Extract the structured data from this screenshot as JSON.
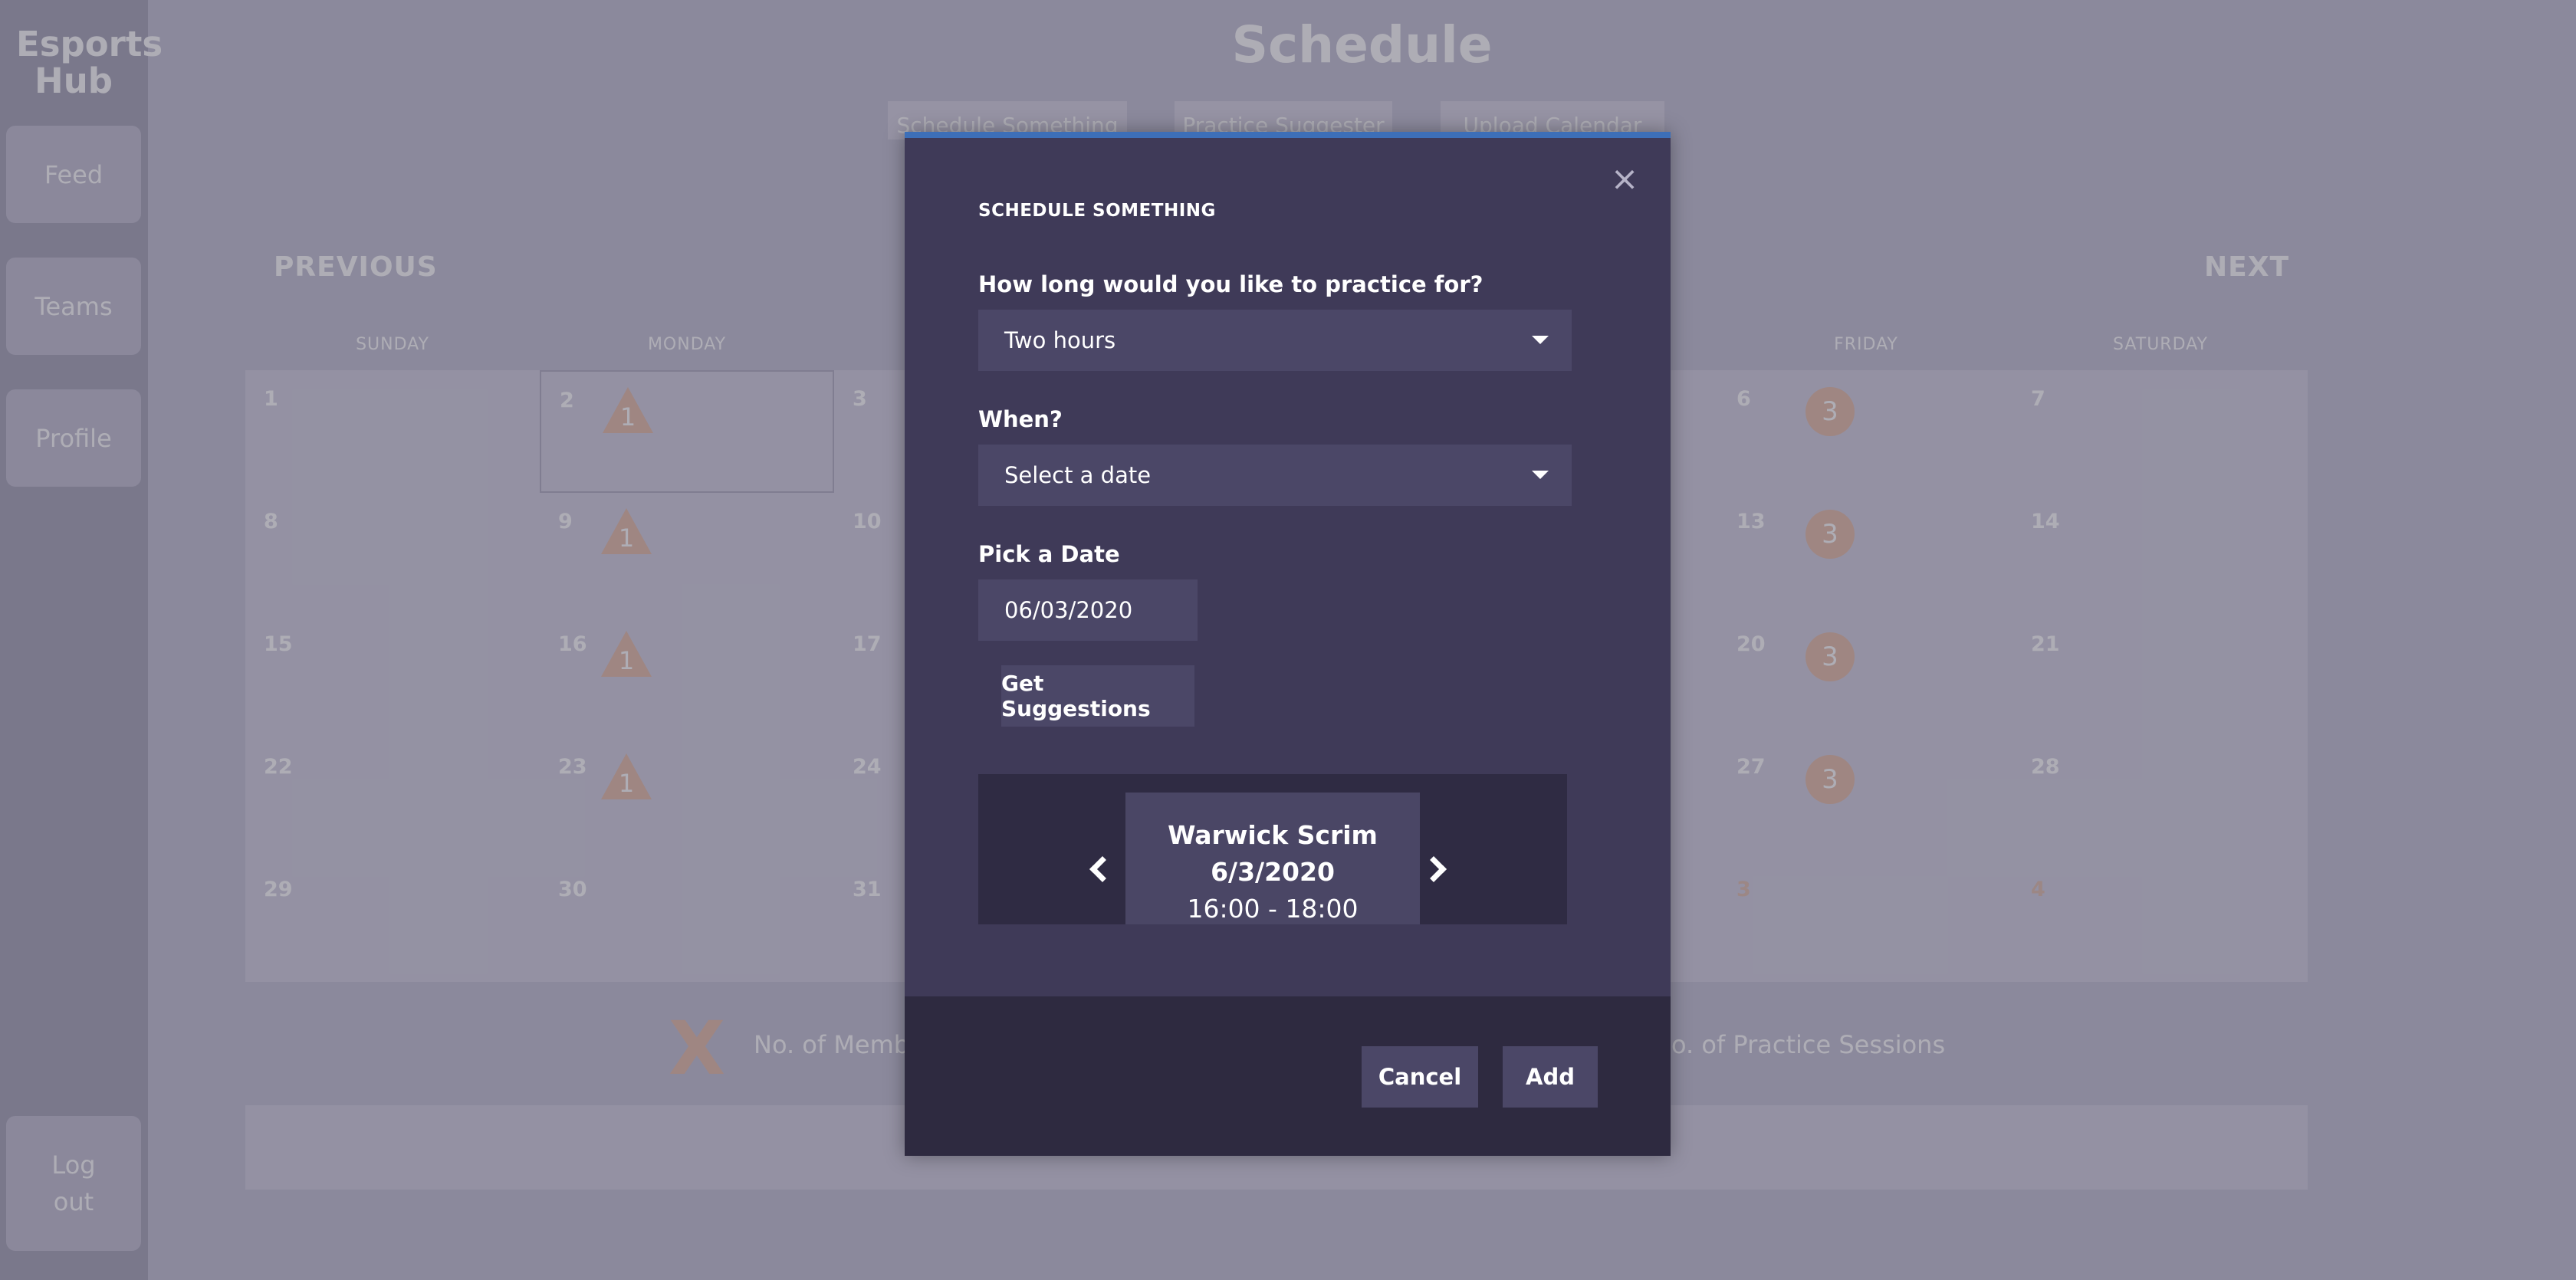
{
  "sidebar": {
    "brand": "Esports Hub",
    "items": [
      {
        "label": "Feed"
      },
      {
        "label": "Teams"
      },
      {
        "label": "Profile"
      }
    ],
    "logout": "Log out"
  },
  "page": {
    "title": "Schedule",
    "top_buttons": [
      "Schedule Something",
      "Practice Suggester",
      "Upload Calendar"
    ]
  },
  "calendar": {
    "previous": "PREVIOUS",
    "next": "NEXT",
    "days_of_week": [
      "SUNDAY",
      "MONDAY",
      "FRIDAY",
      "SATURDAY"
    ],
    "rows": [
      [
        {
          "d": "1"
        },
        {
          "d": "2",
          "tri": "1"
        },
        {
          "d": "3"
        },
        {
          "d": "6",
          "circ": "3"
        },
        {
          "d": "7"
        }
      ],
      [
        {
          "d": "8"
        },
        {
          "d": "9",
          "tri": "1"
        },
        {
          "d": "10"
        },
        {
          "d": "13",
          "circ": "3"
        },
        {
          "d": "14"
        }
      ],
      [
        {
          "d": "15"
        },
        {
          "d": "16",
          "tri": "1"
        },
        {
          "d": "17"
        },
        {
          "d": "20",
          "circ": "3"
        },
        {
          "d": "21"
        }
      ],
      [
        {
          "d": "22"
        },
        {
          "d": "23",
          "tri": "1"
        },
        {
          "d": "24"
        },
        {
          "d": "27",
          "circ": "3"
        },
        {
          "d": "28"
        }
      ],
      [
        {
          "d": "29"
        },
        {
          "d": "30"
        },
        {
          "d": "31"
        },
        {
          "d": "3"
        },
        {
          "d": "4"
        }
      ]
    ],
    "legend": {
      "x_symbol": "X",
      "members_text": "No. of Membe",
      "sessions_text": "o. of Practice Sessions"
    }
  },
  "modal": {
    "title": "SCHEDULE SOMETHING",
    "duration_label": "How long would you like to practice for?",
    "duration_value": "Two hours",
    "when_label": "When?",
    "when_placeholder": "Select a date",
    "pick_date_label": "Pick a Date",
    "date_value": "06/03/2020",
    "suggest_button": "Get Suggestions",
    "suggestion": {
      "name": "Warwick Scrim",
      "date": "6/3/2020",
      "time": "16:00 - 18:00"
    },
    "cancel_button": "Cancel",
    "add_button": "Add",
    "close_symbol": "×"
  },
  "colors": {
    "accent": "#3d6fb8",
    "badge": "#e8c3af",
    "modal_bg": "#3f3a58"
  },
  "icons": [
    "close-icon",
    "chevron-left-icon",
    "chevron-right-icon",
    "caret-down-icon"
  ]
}
